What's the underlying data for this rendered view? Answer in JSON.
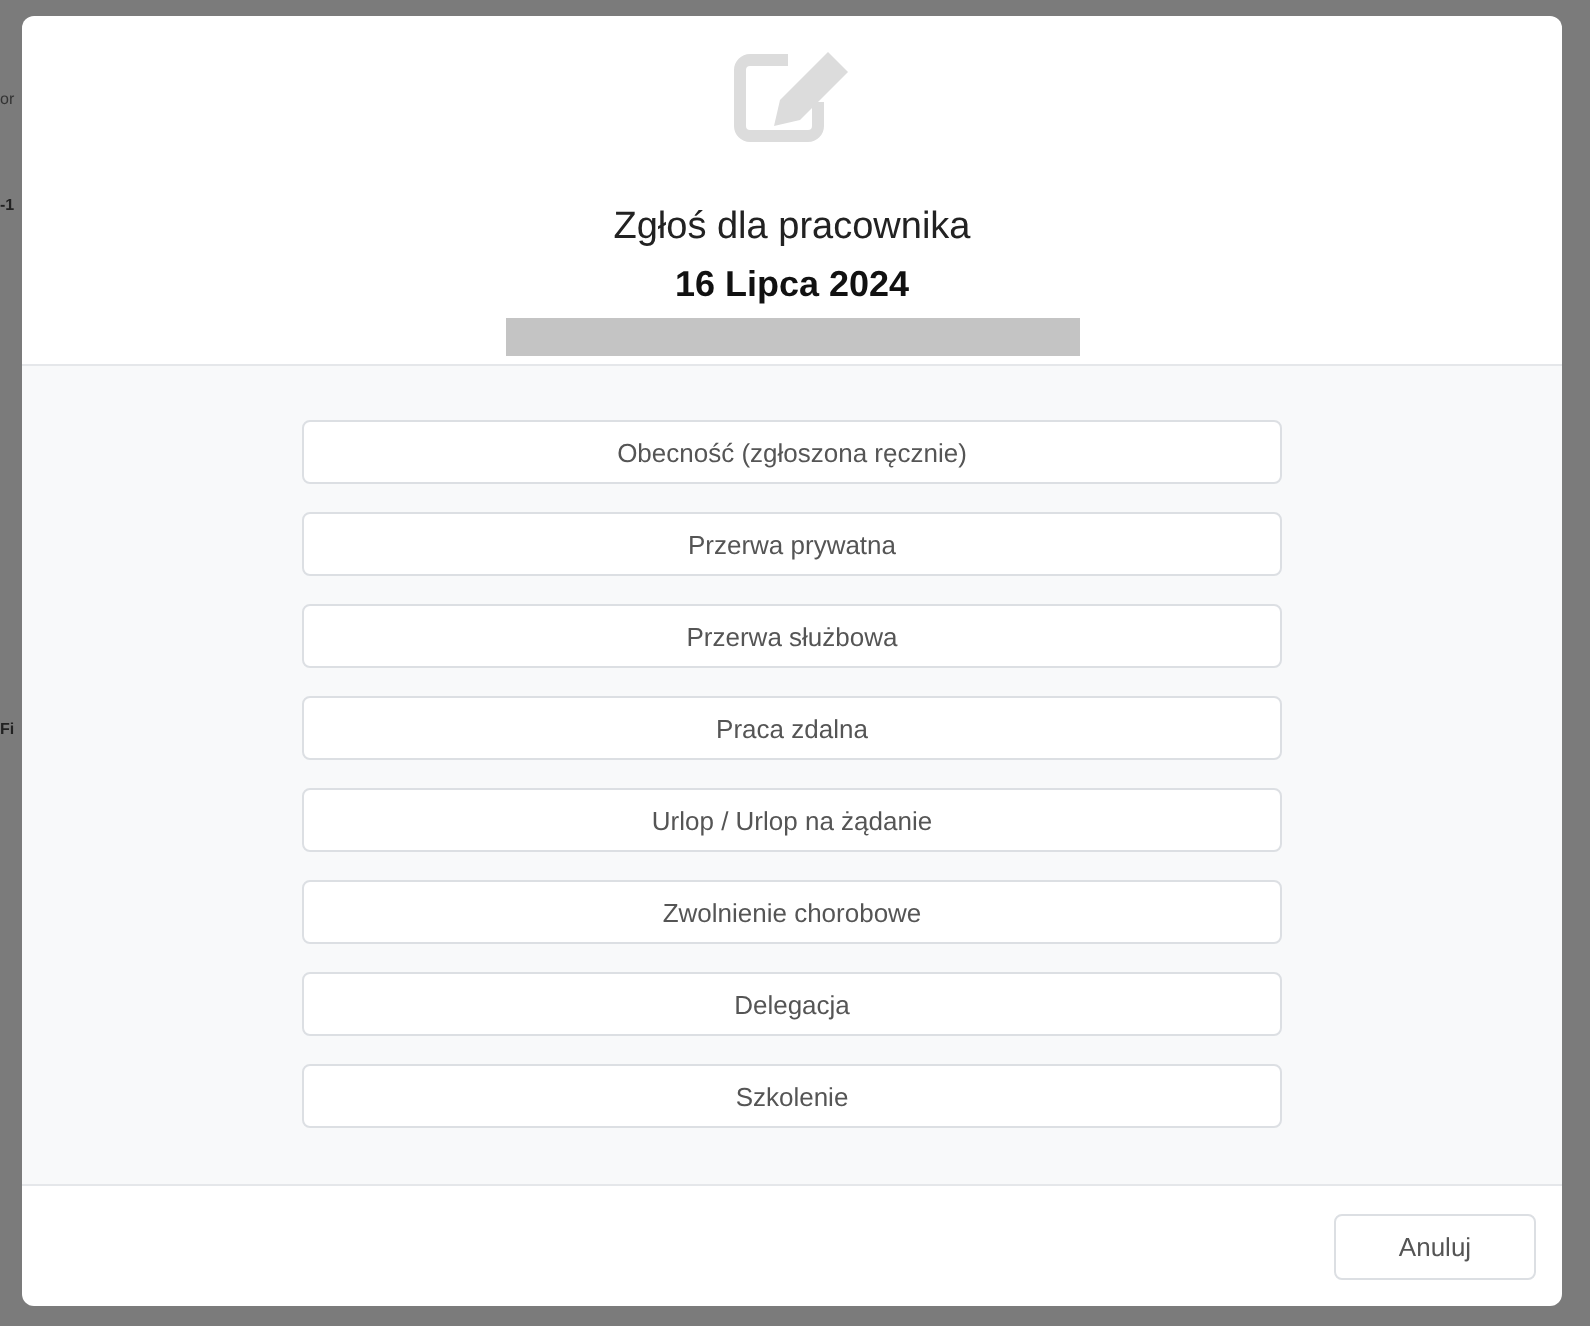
{
  "background": {
    "texts": [
      "or",
      "-1",
      "Fi"
    ]
  },
  "dialog": {
    "title": "Zgłoś dla pracownika",
    "date": "16 Lipca 2024",
    "options": [
      {
        "label": "Obecność (zgłoszona ręcznie)"
      },
      {
        "label": "Przerwa prywatna"
      },
      {
        "label": "Przerwa służbowa"
      },
      {
        "label": "Praca zdalna"
      },
      {
        "label": "Urlop / Urlop na żądanie"
      },
      {
        "label": "Zwolnienie chorobowe"
      },
      {
        "label": "Delegacja"
      },
      {
        "label": "Szkolenie"
      }
    ],
    "cancel": "Anuluj"
  }
}
